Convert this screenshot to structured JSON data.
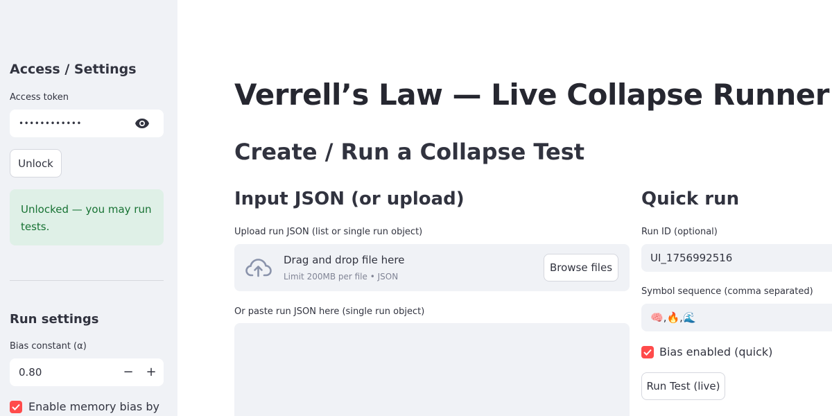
{
  "sidebar": {
    "access_heading": "Access / Settings",
    "access_token_label": "Access token",
    "access_token_value": "••••••••••••",
    "unlock_button": "Unlock",
    "unlock_status": "Unlocked — you may run tests.",
    "run_settings_heading": "Run settings",
    "bias_label": "Bias constant (α)",
    "bias_value": "0.80",
    "bias_decrement": "−",
    "bias_increment": "+",
    "memory_bias_label": "Enable memory bias by",
    "memory_bias_checked": true
  },
  "main": {
    "title": "Verrell’s Law — Live Collapse Runner",
    "subtitle": "Create / Run a Collapse Test",
    "input_section": {
      "heading": "Input JSON (or upload)",
      "upload_label": "Upload run JSON (list or single run object)",
      "dropzone_title": "Drag and drop file here",
      "dropzone_hint": "Limit 200MB per file • JSON",
      "browse_button": "Browse files",
      "paste_label": "Or paste run JSON here (single run object)",
      "paste_value": ""
    },
    "quick_run": {
      "heading": "Quick run",
      "run_id_label": "Run ID (optional)",
      "run_id_value": "UI_1756992516",
      "symbol_label": "Symbol sequence (comma separated)",
      "symbols": [
        "🧠",
        "🔥",
        "🌊"
      ],
      "symbol_separator": ",",
      "bias_enabled_label": "Bias enabled (quick)",
      "bias_enabled_checked": true,
      "run_button": "Run Test (live)"
    }
  },
  "colors": {
    "accent": "#ff4b4b",
    "sidebar_bg": "#f0f2f6",
    "success_bg": "#dff0e7",
    "success_text": "#177233",
    "text": "#31333f"
  }
}
